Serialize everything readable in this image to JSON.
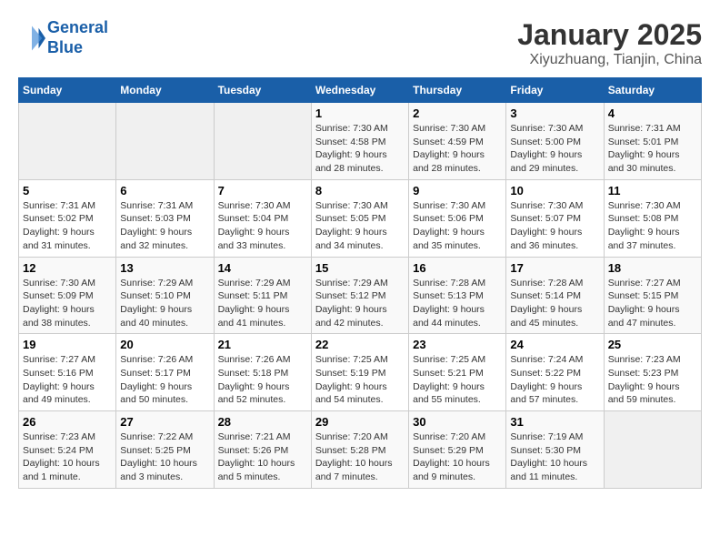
{
  "header": {
    "logo_line1": "General",
    "logo_line2": "Blue",
    "month": "January 2025",
    "location": "Xiyuzhuang, Tianjin, China"
  },
  "days_of_week": [
    "Sunday",
    "Monday",
    "Tuesday",
    "Wednesday",
    "Thursday",
    "Friday",
    "Saturday"
  ],
  "weeks": [
    [
      {
        "day": "",
        "info": ""
      },
      {
        "day": "",
        "info": ""
      },
      {
        "day": "",
        "info": ""
      },
      {
        "day": "1",
        "info": "Sunrise: 7:30 AM\nSunset: 4:58 PM\nDaylight: 9 hours\nand 28 minutes."
      },
      {
        "day": "2",
        "info": "Sunrise: 7:30 AM\nSunset: 4:59 PM\nDaylight: 9 hours\nand 28 minutes."
      },
      {
        "day": "3",
        "info": "Sunrise: 7:30 AM\nSunset: 5:00 PM\nDaylight: 9 hours\nand 29 minutes."
      },
      {
        "day": "4",
        "info": "Sunrise: 7:31 AM\nSunset: 5:01 PM\nDaylight: 9 hours\nand 30 minutes."
      }
    ],
    [
      {
        "day": "5",
        "info": "Sunrise: 7:31 AM\nSunset: 5:02 PM\nDaylight: 9 hours\nand 31 minutes."
      },
      {
        "day": "6",
        "info": "Sunrise: 7:31 AM\nSunset: 5:03 PM\nDaylight: 9 hours\nand 32 minutes."
      },
      {
        "day": "7",
        "info": "Sunrise: 7:30 AM\nSunset: 5:04 PM\nDaylight: 9 hours\nand 33 minutes."
      },
      {
        "day": "8",
        "info": "Sunrise: 7:30 AM\nSunset: 5:05 PM\nDaylight: 9 hours\nand 34 minutes."
      },
      {
        "day": "9",
        "info": "Sunrise: 7:30 AM\nSunset: 5:06 PM\nDaylight: 9 hours\nand 35 minutes."
      },
      {
        "day": "10",
        "info": "Sunrise: 7:30 AM\nSunset: 5:07 PM\nDaylight: 9 hours\nand 36 minutes."
      },
      {
        "day": "11",
        "info": "Sunrise: 7:30 AM\nSunset: 5:08 PM\nDaylight: 9 hours\nand 37 minutes."
      }
    ],
    [
      {
        "day": "12",
        "info": "Sunrise: 7:30 AM\nSunset: 5:09 PM\nDaylight: 9 hours\nand 38 minutes."
      },
      {
        "day": "13",
        "info": "Sunrise: 7:29 AM\nSunset: 5:10 PM\nDaylight: 9 hours\nand 40 minutes."
      },
      {
        "day": "14",
        "info": "Sunrise: 7:29 AM\nSunset: 5:11 PM\nDaylight: 9 hours\nand 41 minutes."
      },
      {
        "day": "15",
        "info": "Sunrise: 7:29 AM\nSunset: 5:12 PM\nDaylight: 9 hours\nand 42 minutes."
      },
      {
        "day": "16",
        "info": "Sunrise: 7:28 AM\nSunset: 5:13 PM\nDaylight: 9 hours\nand 44 minutes."
      },
      {
        "day": "17",
        "info": "Sunrise: 7:28 AM\nSunset: 5:14 PM\nDaylight: 9 hours\nand 45 minutes."
      },
      {
        "day": "18",
        "info": "Sunrise: 7:27 AM\nSunset: 5:15 PM\nDaylight: 9 hours\nand 47 minutes."
      }
    ],
    [
      {
        "day": "19",
        "info": "Sunrise: 7:27 AM\nSunset: 5:16 PM\nDaylight: 9 hours\nand 49 minutes."
      },
      {
        "day": "20",
        "info": "Sunrise: 7:26 AM\nSunset: 5:17 PM\nDaylight: 9 hours\nand 50 minutes."
      },
      {
        "day": "21",
        "info": "Sunrise: 7:26 AM\nSunset: 5:18 PM\nDaylight: 9 hours\nand 52 minutes."
      },
      {
        "day": "22",
        "info": "Sunrise: 7:25 AM\nSunset: 5:19 PM\nDaylight: 9 hours\nand 54 minutes."
      },
      {
        "day": "23",
        "info": "Sunrise: 7:25 AM\nSunset: 5:21 PM\nDaylight: 9 hours\nand 55 minutes."
      },
      {
        "day": "24",
        "info": "Sunrise: 7:24 AM\nSunset: 5:22 PM\nDaylight: 9 hours\nand 57 minutes."
      },
      {
        "day": "25",
        "info": "Sunrise: 7:23 AM\nSunset: 5:23 PM\nDaylight: 9 hours\nand 59 minutes."
      }
    ],
    [
      {
        "day": "26",
        "info": "Sunrise: 7:23 AM\nSunset: 5:24 PM\nDaylight: 10 hours\nand 1 minute."
      },
      {
        "day": "27",
        "info": "Sunrise: 7:22 AM\nSunset: 5:25 PM\nDaylight: 10 hours\nand 3 minutes."
      },
      {
        "day": "28",
        "info": "Sunrise: 7:21 AM\nSunset: 5:26 PM\nDaylight: 10 hours\nand 5 minutes."
      },
      {
        "day": "29",
        "info": "Sunrise: 7:20 AM\nSunset: 5:28 PM\nDaylight: 10 hours\nand 7 minutes."
      },
      {
        "day": "30",
        "info": "Sunrise: 7:20 AM\nSunset: 5:29 PM\nDaylight: 10 hours\nand 9 minutes."
      },
      {
        "day": "31",
        "info": "Sunrise: 7:19 AM\nSunset: 5:30 PM\nDaylight: 10 hours\nand 11 minutes."
      },
      {
        "day": "",
        "info": ""
      }
    ]
  ]
}
